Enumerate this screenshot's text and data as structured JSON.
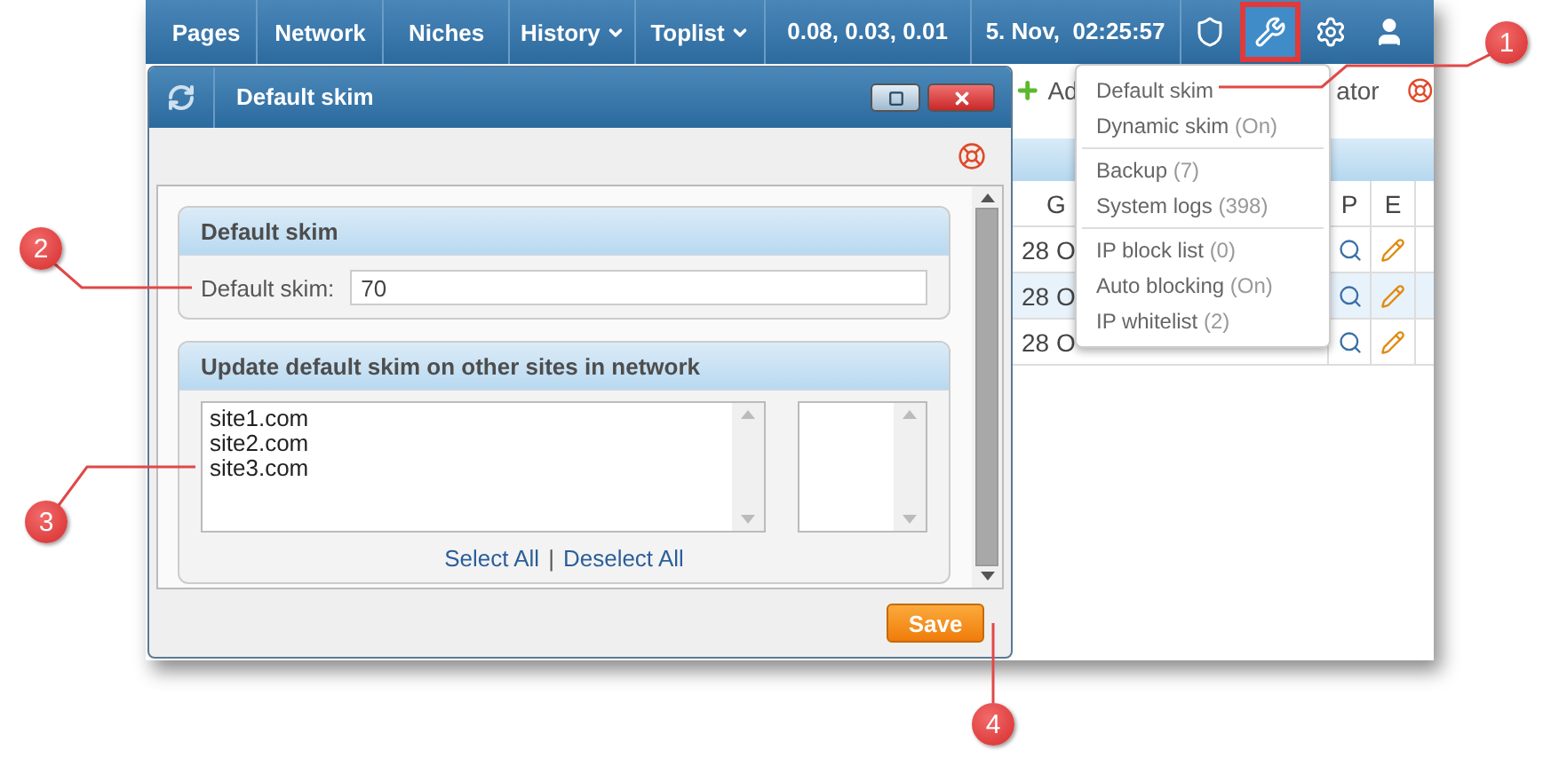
{
  "nav": {
    "items": [
      {
        "label": "Pages",
        "dropdown": false
      },
      {
        "label": "Network",
        "dropdown": false
      },
      {
        "label": "Niches",
        "dropdown": false
      },
      {
        "label": "History",
        "dropdown": true
      },
      {
        "label": "Toplist",
        "dropdown": true
      }
    ],
    "load": "0.08, 0.03, 0.01",
    "clock": "5. Nov,  02:25:57",
    "icons": [
      {
        "kind": "shield",
        "selected": false
      },
      {
        "kind": "tools",
        "selected": true
      },
      {
        "kind": "gear",
        "selected": false
      },
      {
        "kind": "user",
        "selected": false
      }
    ]
  },
  "page": {
    "toolbar": [
      "Ad",
      "ator"
    ],
    "table": {
      "columns": [
        "G",
        "P",
        "E"
      ],
      "rows": [
        {
          "cell": "28 O",
          "selected": false
        },
        {
          "cell": "28 O",
          "selected": true
        },
        {
          "cell": "28 O",
          "selected": false
        }
      ]
    }
  },
  "menu": {
    "groups": [
      [
        {
          "label": "Default skim"
        },
        {
          "label": "Dynamic skim",
          "count": "(On)"
        }
      ],
      [
        {
          "label": "Backup",
          "count": "(7)"
        },
        {
          "label": "System logs",
          "count": "(398)"
        }
      ],
      [
        {
          "label": "IP block list",
          "count": "(0)"
        },
        {
          "label": "Auto blocking",
          "count": "(On)"
        },
        {
          "label": "IP whitelist",
          "count": "(2)"
        }
      ]
    ]
  },
  "dialog": {
    "title": "Default skim",
    "skim_section": {
      "title": "Default skim",
      "label": "Default skim:",
      "value": "70"
    },
    "network_section": {
      "title": "Update default skim on other sites in network",
      "sites": [
        "site1.com",
        "site2.com",
        "site3.com"
      ],
      "select_all": "Select All",
      "separator": "|",
      "deselect_all": "Deselect All"
    },
    "save": "Save"
  },
  "callouts": [
    "1",
    "2",
    "3",
    "4"
  ]
}
